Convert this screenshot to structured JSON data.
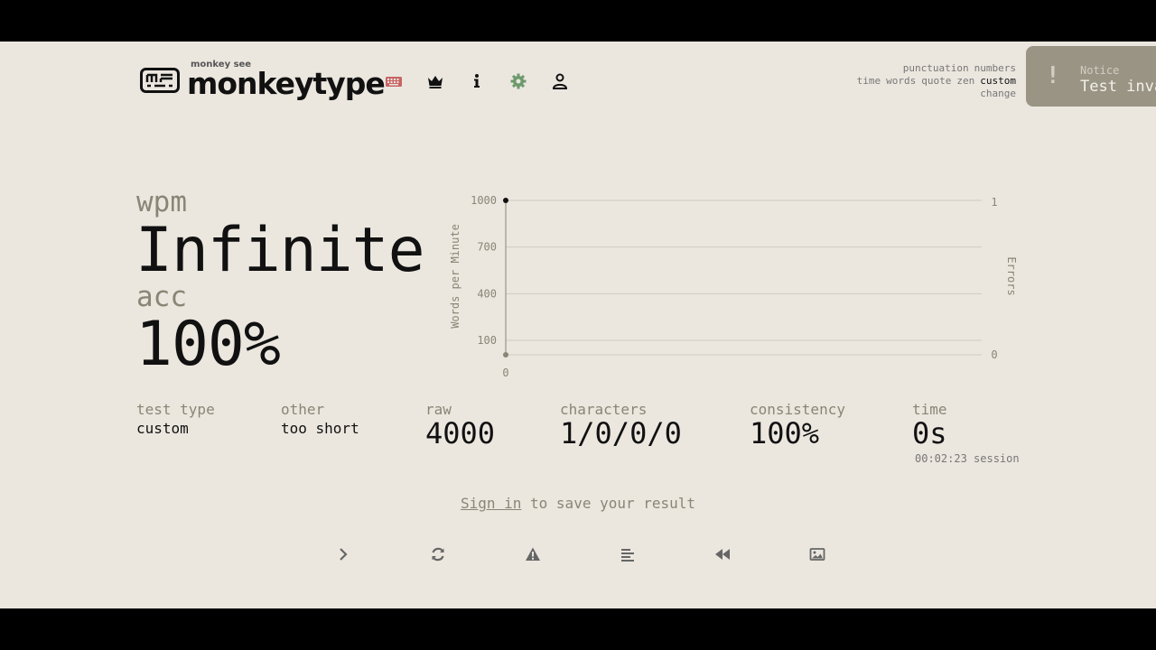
{
  "header": {
    "logo_small": "monkey see",
    "logo_text": "monkeytype",
    "nav": [
      {
        "name": "keyboard-icon",
        "color": "#c86464"
      },
      {
        "name": "crown-icon",
        "color": "#111111"
      },
      {
        "name": "info-icon",
        "color": "#111111"
      },
      {
        "name": "gear-icon",
        "color": "#6c9a6c"
      },
      {
        "name": "user-icon",
        "color": "#111111"
      }
    ]
  },
  "config": {
    "row1": [
      "punctuation",
      "numbers"
    ],
    "row2": [
      "time",
      "words",
      "quote",
      "zen",
      "custom"
    ],
    "active": "custom",
    "change": "change"
  },
  "notice": {
    "title": "Notice",
    "text": "Test inva"
  },
  "results": {
    "wpm_label": "wpm",
    "wpm_value": "Infinite",
    "acc_label": "acc",
    "acc_value": "100%"
  },
  "stats": {
    "test_type_label": "test type",
    "test_type_value": "custom",
    "other_label": "other",
    "other_value": "too short",
    "raw_label": "raw",
    "raw_value": "4000",
    "characters_label": "characters",
    "characters_value": "1/0/0/0",
    "consistency_label": "consistency",
    "consistency_value": "100%",
    "time_label": "time",
    "time_value": "0s",
    "session": "00:02:23 session"
  },
  "signin": {
    "link": "Sign in",
    "rest": " to save your result"
  },
  "chart_data": {
    "type": "line",
    "ylabel": "Words per Minute",
    "y2label": "Errors",
    "x_ticks": [
      "0"
    ],
    "y_ticks": [
      100,
      400,
      700,
      1000
    ],
    "y2_ticks": [
      0,
      1
    ],
    "ylim": [
      0,
      1000
    ],
    "y2lim": [
      0,
      1
    ],
    "series": [
      {
        "values": [
          {
            "x": 0,
            "y": 1000
          }
        ]
      },
      {
        "values": [
          {
            "x": 0,
            "y": 0
          }
        ]
      }
    ],
    "colors": {
      "wpm": "#111111",
      "raw": "#8a8575",
      "grid": "#cfcac0"
    }
  },
  "accent": "#8a8575"
}
